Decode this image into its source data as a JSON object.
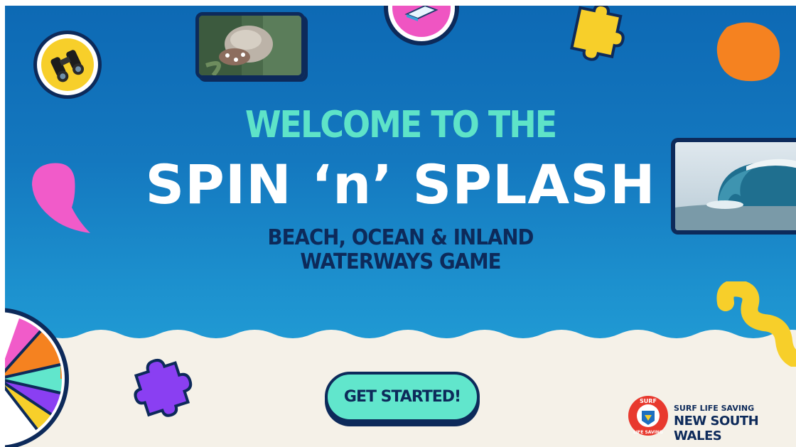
{
  "screen": {
    "welcome": "WELCOME TO THE",
    "title": "SPIN ‘n’ SPLASH",
    "subtitle_line1": "BEACH, OCEAN & INLAND",
    "subtitle_line2": "WATERWAYS GAME",
    "button_label": "GET STARTED!"
  },
  "logo": {
    "line1": "SURF LIFE SAVING",
    "line2": "NEW SOUTH WALES",
    "emblem_text_top": "SURF",
    "emblem_text_bottom": "LIFE SAVING"
  },
  "decorations": {
    "icons": [
      "binoculars-icon",
      "book-icon",
      "puzzle-piece-icon",
      "spinner-wheel-icon"
    ],
    "photos": [
      "crab-photo",
      "wave-photo"
    ]
  },
  "colors": {
    "ocean_top": "#0d69b4",
    "ocean_bottom": "#27a9dd",
    "sand": "#f5f1e8",
    "accent_mint": "#61e6cc",
    "navy": "#0d2a5a",
    "yellow": "#f7cf2a",
    "orange": "#f58220",
    "pink": "#f15bc9",
    "purple": "#8a3ff2"
  }
}
